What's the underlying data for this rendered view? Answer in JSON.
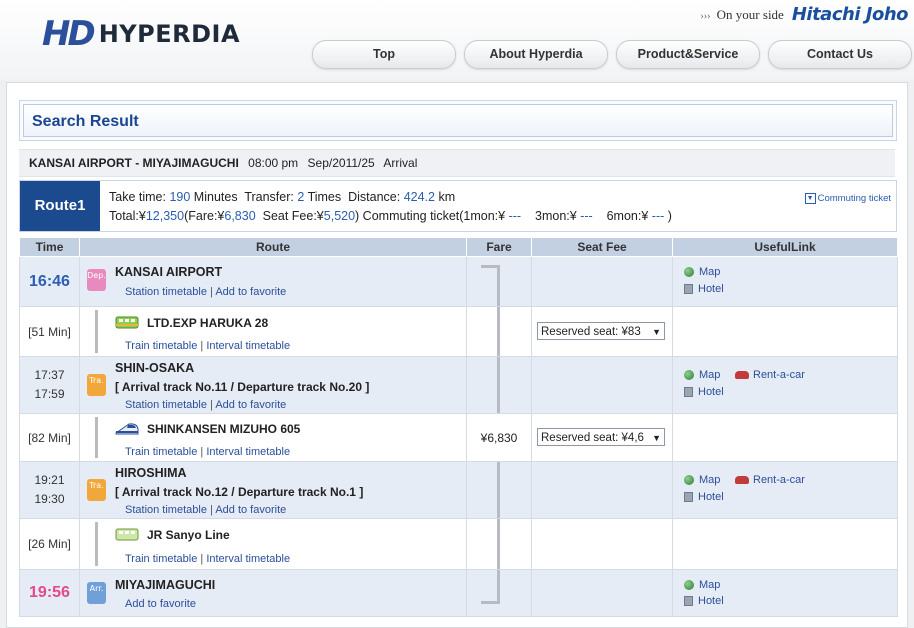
{
  "header": {
    "logo_mark": "HD",
    "logo_text": "HYPERDIA",
    "tagline_arrows": "›››",
    "tagline": "On your side",
    "brand": "Hitachi Joho",
    "nav": [
      "Top",
      "About Hyperdia",
      "Product&Service",
      "Contact Us"
    ]
  },
  "search": {
    "title": "Search Result",
    "route_pair": "KANSAI AIRPORT - MIYAJIMAGUCHI",
    "time": "08:00 pm",
    "date": "Sep/2011/25",
    "type": "Arrival"
  },
  "route": {
    "badge": "Route1",
    "take_time_label": "Take time:",
    "take_time": "190",
    "minutes_label": "Minutes",
    "transfer_label": "Transfer:",
    "transfer": "2",
    "times_label": "Times",
    "distance_label": "Distance:",
    "distance": "424.2",
    "km_label": "km",
    "total_label": "Total:¥",
    "total": "12,350",
    "fare_label": "(Fare:¥",
    "fare": "6,830",
    "seat_fee_label": "Seat Fee:¥",
    "seat_fee": "5,520",
    "commuting_label": ") Commuting ticket(1mon:¥",
    "mon1": "---",
    "mon3_label": "3mon:¥",
    "mon3": "---",
    "mon6_label": "6mon:¥",
    "mon6": "---",
    "close_paren": ")",
    "commuting_link": "Commuting ticket",
    "commuting_icon": "▼"
  },
  "table": {
    "headers": [
      "Time",
      "Route",
      "Fare",
      "Seat Fee",
      "UsefulLink"
    ]
  },
  "rows": {
    "kansai": {
      "time": "16:46",
      "icon": "Dep.",
      "name": "KANSAI AIRPORT",
      "link1": "Station timetable",
      "sep": "|",
      "link2": "Add to favorite",
      "map": "Map",
      "hotel": "Hotel"
    },
    "haruka": {
      "duration": "[51 Min]",
      "name": "LTD.EXP HARUKA 28",
      "link1": "Train timetable",
      "sep": "|",
      "link2": "Interval timetable",
      "seat": "Reserved seat: ¥83",
      "arrow": "▼"
    },
    "shinosaka": {
      "arr": "17:37",
      "dep": "17:59",
      "icon": "Tra.",
      "name": "SHIN-OSAKA",
      "track": "[ Arrival track No.11 / Departure track No.20 ]",
      "link1": "Station timetable",
      "sep": "|",
      "link2": "Add to favorite",
      "map": "Map",
      "car": "Rent-a-car",
      "hotel": "Hotel"
    },
    "mizuho": {
      "duration": "[82 Min]",
      "name": "SHINKANSEN MIZUHO 605",
      "fare": "¥6,830",
      "link1": "Train timetable",
      "sep": "|",
      "link2": "Interval timetable",
      "seat": "Reserved seat: ¥4,6",
      "arrow": "▼"
    },
    "hiroshima": {
      "arr": "19:21",
      "dep": "19:30",
      "icon": "Tra.",
      "name": "HIROSHIMA",
      "track": "[ Arrival track No.12 / Departure track No.1 ]",
      "link1": "Station timetable",
      "sep": "|",
      "link2": "Add to favorite",
      "map": "Map",
      "car": "Rent-a-car",
      "hotel": "Hotel"
    },
    "sanyo": {
      "duration": "[26 Min]",
      "name": "JR Sanyo Line",
      "link1": "Train timetable",
      "sep": "|",
      "link2": "Interval timetable"
    },
    "miyajima": {
      "time": "19:56",
      "icon": "Arr.",
      "name": "MIYAJIMAGUCHI",
      "link1": "Add to favorite",
      "map": "Map",
      "hotel": "Hotel"
    }
  }
}
